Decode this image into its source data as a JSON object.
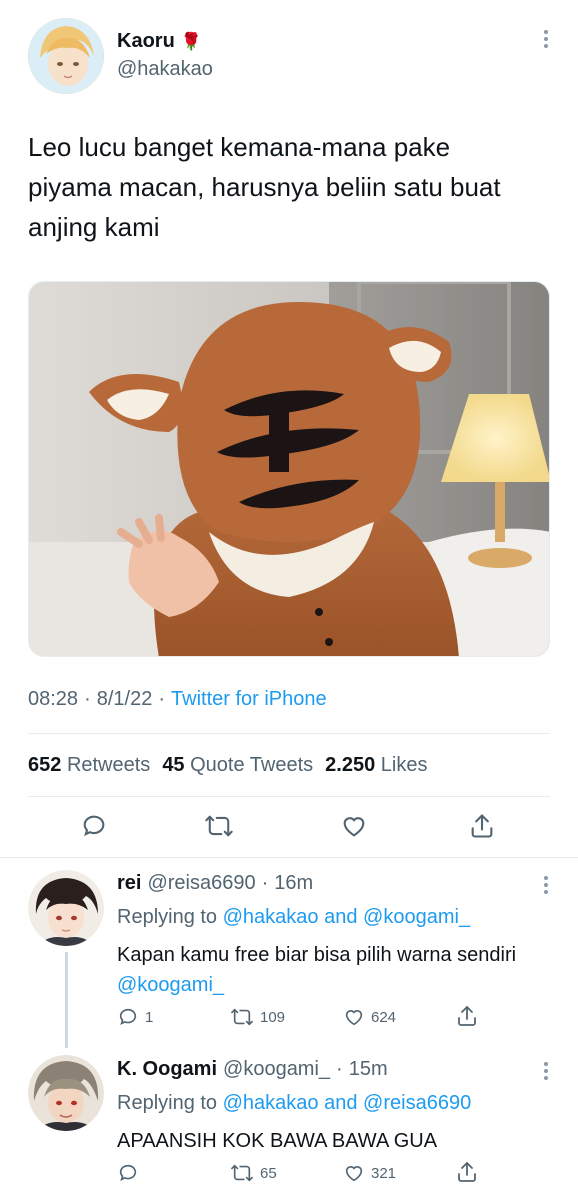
{
  "tweet": {
    "display_name": "Kaoru",
    "name_emoji": "🌹",
    "handle": "@hakakao",
    "text": "Leo lucu banget kemana-mana pake piyama macan, harusnya beliin satu buat anjing kami",
    "time": "08:28",
    "date": "8/1/22",
    "source": "Twitter for iPhone",
    "stats": {
      "retweets_count": "652",
      "retweets_label": "Retweets",
      "quotes_count": "45",
      "quotes_label": "Quote Tweets",
      "likes_count": "2.250",
      "likes_label": "Likes"
    },
    "actions": [
      "reply-icon",
      "retweet-icon",
      "like-icon",
      "share-icon"
    ]
  },
  "replies": [
    {
      "display_name": "rei",
      "handle": "@reisa6690",
      "age": "16m",
      "replying_prefix": "Replying to",
      "replying_to_1": "@hakakao",
      "replying_and": "and",
      "replying_to_2": "@koogami_",
      "text_part": "Kapan kamu free biar bisa pilih warna sendiri",
      "text_mention": "@koogami_",
      "reply_count": "1",
      "retweet_count": "109",
      "like_count": "624"
    },
    {
      "display_name": "K. Oogami",
      "handle": "@koogami_",
      "age": "15m",
      "replying_prefix": "Replying to",
      "replying_to_1": "@hakakao",
      "replying_and": "and",
      "replying_to_2": "@reisa6690",
      "text": "APAANSIH KOK BAWA BAWA GUA",
      "reply_count": "",
      "retweet_count": "65",
      "like_count": "321"
    }
  ],
  "colors": {
    "accent": "#1d9bf0",
    "text": "#0f1419",
    "muted": "#536471",
    "divider": "#e6ecf0"
  }
}
